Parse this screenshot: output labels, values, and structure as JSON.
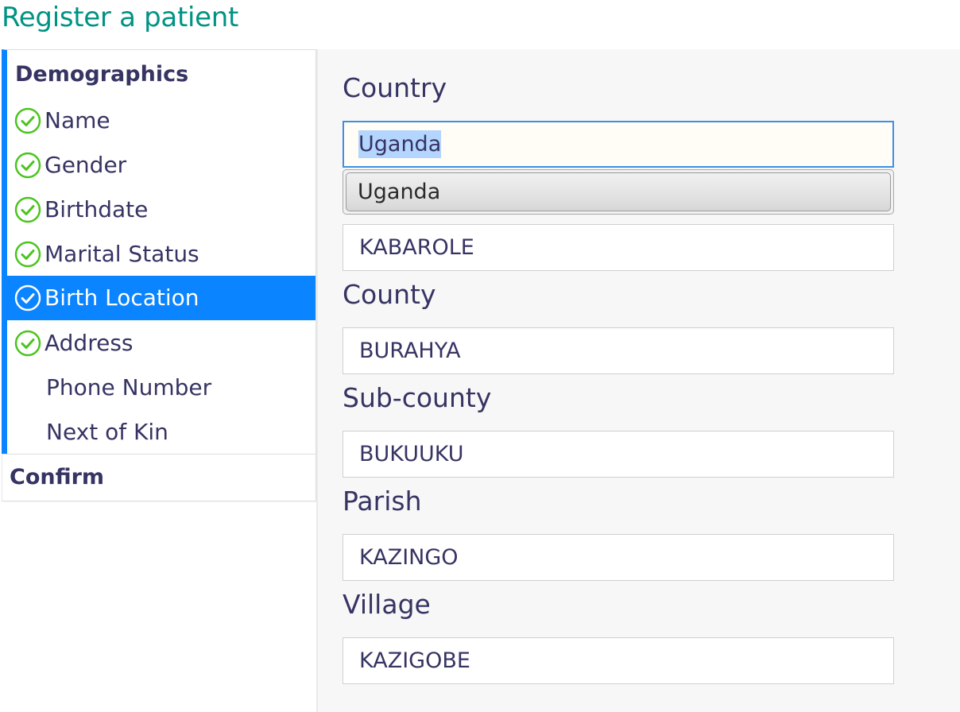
{
  "page": {
    "title": "Register a patient"
  },
  "nav": {
    "demographics_heading": "Demographics",
    "items": [
      {
        "label": "Name",
        "completed": true,
        "active": false
      },
      {
        "label": "Gender",
        "completed": true,
        "active": false
      },
      {
        "label": "Birthdate",
        "completed": true,
        "active": false
      },
      {
        "label": "Marital Status",
        "completed": true,
        "active": false
      },
      {
        "label": "Birth Location",
        "completed": true,
        "active": true
      },
      {
        "label": "Address",
        "completed": true,
        "active": false
      },
      {
        "label": "Phone Number",
        "completed": false,
        "active": false
      },
      {
        "label": "Next of Kin",
        "completed": false,
        "active": false
      }
    ],
    "confirm_heading": "Confirm",
    "check_icon": "check-circle-icon"
  },
  "form": {
    "country": {
      "label": "Country",
      "value": "Uganda"
    },
    "autocomplete": {
      "options": [
        "Uganda"
      ]
    },
    "district": {
      "value": "KABAROLE"
    },
    "county": {
      "label": "County",
      "value": "BURAHYA"
    },
    "subcounty": {
      "label": "Sub-county",
      "value": "BUKUUKU"
    },
    "parish": {
      "label": "Parish",
      "value": "KAZINGO"
    },
    "village": {
      "label": "Village",
      "value": "KAZIGOBE"
    }
  },
  "colors": {
    "title": "#009384",
    "accent": "#0b84ff",
    "check_green": "#4bc41d",
    "text": "#363463"
  }
}
